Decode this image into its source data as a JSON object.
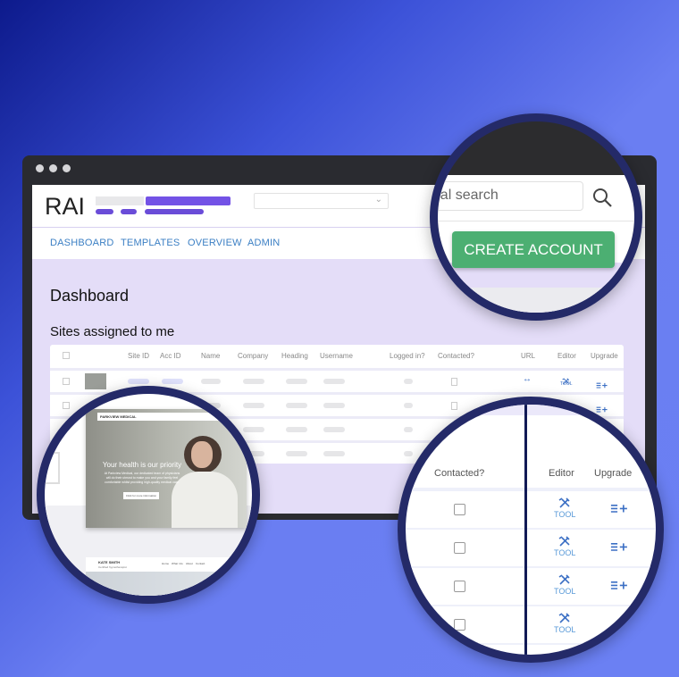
{
  "window": {
    "controls": [
      "close",
      "minimize",
      "maximize"
    ]
  },
  "header": {
    "logo": "RAI",
    "dropdown_value": "",
    "search_placeholder": "Global search",
    "search_icon": "search-icon",
    "create_button": "CREATE ACCOUNT"
  },
  "nav": [
    {
      "label": "DASHBOARD"
    },
    {
      "label": "TEMPLATES"
    },
    {
      "label": "OVERVIEW"
    },
    {
      "label": "ADMIN"
    }
  ],
  "main": {
    "title": "Dashboard",
    "section_title": "Sites assigned to me"
  },
  "table": {
    "columns": [
      "Site ID",
      "Acc ID",
      "Name",
      "Company",
      "Heading",
      "Username",
      "Logged in?",
      "Contacted?",
      "URL",
      "Editor",
      "Upgrade"
    ],
    "tool_label": "TOOL",
    "rows": 4
  },
  "preview": {
    "brand": "PARKVIEW MEDICAL",
    "headline": "Your health is our priority",
    "body": "At Parkview Medical, our dedicated team of physicians will do their utmost to make you and your family feel comfortable whilst providing high-quality medical care.",
    "cta": "Click for more information",
    "brand2": "KATE SMITH",
    "brand2_sub": "Certified hypnotherapist",
    "nav2": [
      "Home",
      "What I do",
      "About",
      "Contact"
    ]
  },
  "colors": {
    "accent": "#7352e6",
    "button": "#4caf72",
    "link": "#3b7fc4",
    "ring": "#242a68"
  }
}
